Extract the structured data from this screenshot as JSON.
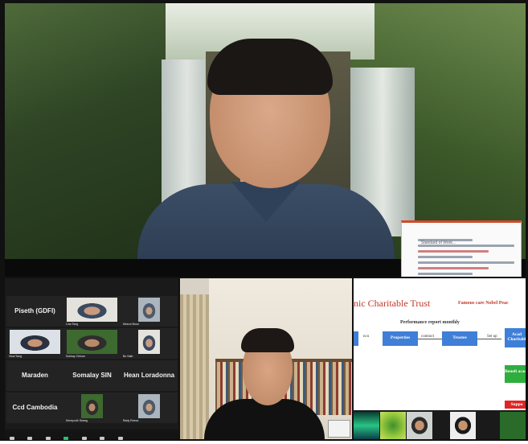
{
  "main_speaker": {
    "shared_doc_label": "Standard of Work..."
  },
  "gallery": {
    "tiles": [
      {
        "name": "Piseth (GDFI)",
        "caption": ""
      },
      {
        "name": "",
        "caption": "Lina Tang"
      },
      {
        "name": "",
        "caption": "Moeun Boun"
      },
      {
        "name": "",
        "caption": "Visal Tang"
      },
      {
        "name": "",
        "caption": "Sokhay Chhorn"
      },
      {
        "name": "",
        "caption": "Bo Sath"
      },
      {
        "name": "Maraden",
        "caption": ""
      },
      {
        "name": "Somalay SIN",
        "caption": ""
      },
      {
        "name": "Hean Loradonna",
        "caption": ""
      },
      {
        "name": "Ccd Cambodia",
        "caption": ""
      },
      {
        "name": "",
        "caption": "Sereyvuth Seang"
      },
      {
        "name": "",
        "caption": "Rady Roeun"
      }
    ]
  },
  "shared_screen": {
    "title": "nic Charitable Trust",
    "subtitle": "Famous care   Nobel Peac",
    "section": "Performance report monthly",
    "boxes": {
      "properties": "Properties",
      "trustee": "Trustee",
      "academy": "Acad Charitabl",
      "beneficiary": "Benefi acade",
      "support": "Suppo"
    },
    "labels": {
      "left": "ncu",
      "mid": "contract",
      "right": "Set up"
    }
  },
  "colors": {
    "title_red": "#c0392b",
    "box_blue": "#3f7fd8",
    "box_green": "#2eae3d",
    "box_red": "#e02424",
    "gallery_bg": "#1a1a1a",
    "mute_green": "#29c46b"
  }
}
